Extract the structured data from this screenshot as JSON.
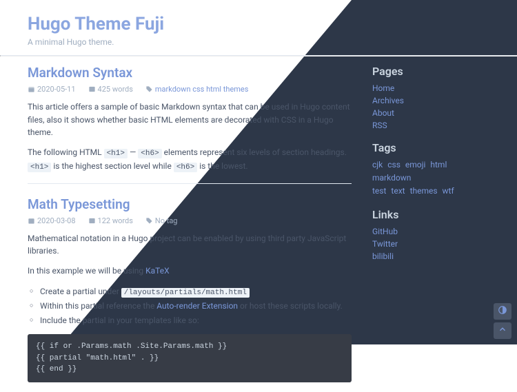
{
  "site": {
    "title": "Hugo Theme Fuji",
    "subtitle": "A minimal Hugo theme."
  },
  "posts": [
    {
      "title": "Markdown Syntax",
      "date": "2020-05-11",
      "words": "425 words",
      "tags": "markdown css html themes",
      "para1": "This article offers a sample of basic Markdown syntax that can be used in Hugo content files, also it shows whether basic HTML elements are decorated with CSS in a Hugo theme.",
      "para2_a": "The following HTML ",
      "para2_b": " — ",
      "para2_c": " elements represent six levels of section headings. ",
      "para2_d": " is the highest section level while ",
      "para2_e": " is the lowest.",
      "code_h1": "<h1>",
      "code_h6": "<h6>"
    },
    {
      "title": "Math Typesetting",
      "date": "2020-03-08",
      "words": "122 words",
      "no_tag": "No tag",
      "para1": "Mathematical notation in a Hugo project can be enabled by using third party JavaScript libraries.",
      "para2_a": "In this example we will be using ",
      "katex": "KaTeX",
      "li1_a": "Create a partial under ",
      "li1_code": "/layouts/partials/math.html",
      "li2_a": "Within this partial reference the ",
      "li2_link": "Auto-render Extension",
      "li2_b": " or host these scripts locally.",
      "li3": "Include the partial in your templates like so:",
      "codeblock": "{{ if or .Params.math .Site.Params.math }}\n{{ partial \"math.html\" . }}\n{{ end }}"
    }
  ],
  "sidebar": {
    "pages": {
      "title": "Pages",
      "items": [
        "Home",
        "Archives",
        "About",
        "RSS"
      ]
    },
    "tags": {
      "title": "Tags",
      "items": [
        "cjk",
        "css",
        "emoji",
        "html",
        "markdown",
        "test",
        "text",
        "themes",
        "wtf"
      ]
    },
    "links": {
      "title": "Links",
      "items": [
        "GitHub",
        "Twitter",
        "bilibili"
      ]
    }
  }
}
